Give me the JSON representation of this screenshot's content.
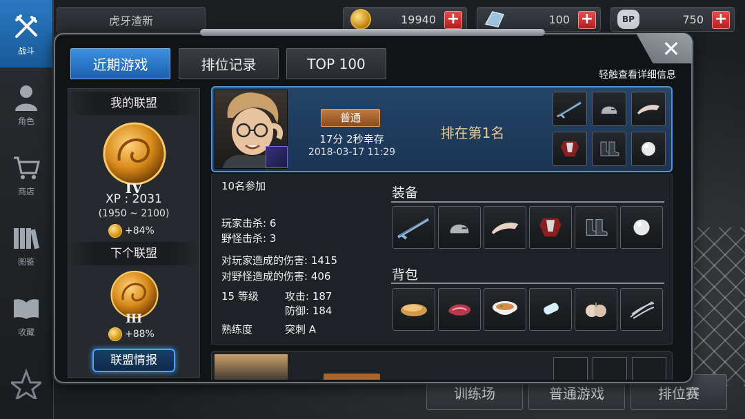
{
  "nav": {
    "items": [
      {
        "label": "战斗",
        "icon": "crossed-weapons-icon",
        "active": true
      },
      {
        "label": "角色",
        "icon": "character-icon",
        "active": false
      },
      {
        "label": "商店",
        "icon": "shopping-cart-icon",
        "active": false
      },
      {
        "label": "图鉴",
        "icon": "books-icon",
        "active": false
      },
      {
        "label": "收藏",
        "icon": "open-book-icon",
        "active": false
      }
    ]
  },
  "topbar": {
    "channel": "虎牙渣新",
    "currencies": [
      {
        "icon": "gold-coin-icon",
        "value": "19940"
      },
      {
        "icon": "crystal-icon",
        "value": "100"
      },
      {
        "icon": "bp-icon",
        "value": "750"
      }
    ]
  },
  "bottom_buttons": [
    "训练场",
    "普通游戏",
    "排位赛"
  ],
  "modal": {
    "tabs": [
      {
        "label": "近期游戏",
        "active": true
      },
      {
        "label": "排位记录",
        "active": false
      },
      {
        "label": "TOP 100",
        "active": false
      }
    ],
    "hint": "轻触查看详细信息",
    "close": "✕"
  },
  "league": {
    "my_title": "我的联盟",
    "my_tier": "IV",
    "xp": "XP : 2031",
    "range": "(1950 ~ 2100)",
    "my_pct": "+84%",
    "next_title": "下个联盟",
    "next_tier": "III",
    "next_pct": "+88%",
    "info_button": "联盟情报"
  },
  "record": {
    "mode": "普通",
    "survive": "17分 2秒幸存",
    "time": "2018-03-17 11:29",
    "rank": "排在第1名",
    "slots": [
      "blade-icon",
      "helmet-icon",
      "arm-guard-icon",
      "chest-armor-icon",
      "boots-icon",
      "orb-icon"
    ]
  },
  "details": {
    "participants": "10名参加",
    "player_kills": "玩家击杀: 6",
    "monster_kills": "野怪击杀: 3",
    "player_damage": "对玩家造成的伤害: 1415",
    "monster_damage": "对野怪造成的伤害: 406",
    "level": "15 等级",
    "attack": "攻击: 187",
    "defense": "防御: 184",
    "mastery_label": "熟练度",
    "mastery_value": "突刺 A",
    "equip_title": "装备",
    "bag_title": "背包",
    "equipment": [
      "blade-icon",
      "helmet-icon",
      "arm-guard-icon",
      "chest-armor-icon",
      "boots-icon",
      "orb-icon"
    ],
    "bag": [
      "bread-icon",
      "meat-icon",
      "soup-bowl-icon",
      "bandage-icon",
      "garlic-icon",
      "claws-icon"
    ]
  }
}
